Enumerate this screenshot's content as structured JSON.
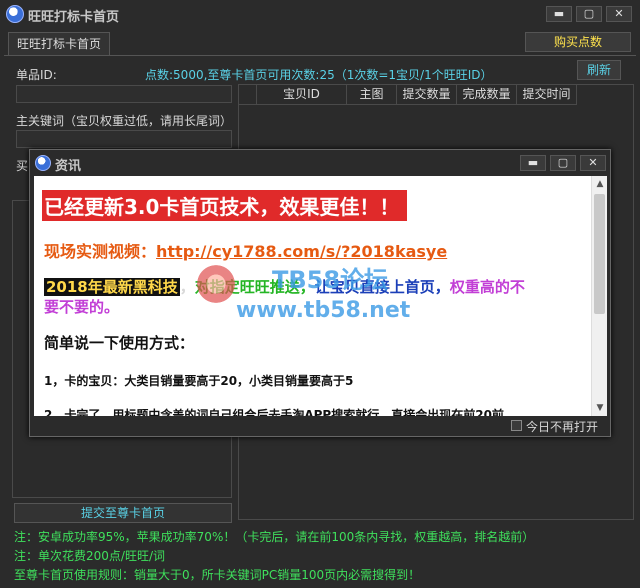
{
  "window": {
    "title": "旺旺打标卡首页"
  },
  "tab": {
    "label": "旺旺打标卡首页"
  },
  "buttons": {
    "buy": "购买点数",
    "refresh": "刷新",
    "submit": "提交至尊卡首页",
    "minimize": "▬",
    "maximize": "▢",
    "close": "✕"
  },
  "form": {
    "product_id_label": "单品ID:",
    "points_info": "点数:5000,至尊卡首页可用次数:25（1次数=1宝贝/1个旺旺ID）",
    "keyword_label": "主关键词（宝贝权重过低，请用长尾词）",
    "partial_label": "买"
  },
  "table": {
    "columns": [
      "宝贝ID",
      "主图",
      "提交数量",
      "完成数量",
      "提交时间"
    ]
  },
  "notes": {
    "note1": "注：安卓成功率95%，苹果成功率70%！（卡完后，请在前100条内寻找，权重越高，排名越前）",
    "note2": "注：单次花费200点/旺旺/词",
    "note3": "至尊卡首页使用规则：销量大于0，所卡关键词PC销量100页内必需搜得到！"
  },
  "popup": {
    "title": "资讯",
    "headline": "已经更新3.0卡首页技术，效果更佳！！",
    "video_label": "现场实测视频：",
    "video_link": "http://cy1788.com/s/?2018kasye",
    "black_tech": "2018年最新黑科技",
    "comma1": "，",
    "s1": "对指定旺旺",
    "s2": "推送，",
    "s3": "让宝贝直接上首页，",
    "s4": "权重高的不",
    "s5": "要不要的。",
    "usage_title": "简单说一下使用方式：",
    "step1": "1，卡的宝贝：大类目销量要高于20，小类目销量要高于5",
    "step2": "2，卡完了，用标题中含盖的词自己组合后去手淘APP搜索就行，直接会出现在前20前",
    "dont_show": "今日不再打开",
    "scroll_up": "▲",
    "scroll_down": "▼"
  },
  "watermark": {
    "text1": "TB58论坛",
    "text2": "www.tb58.net"
  }
}
